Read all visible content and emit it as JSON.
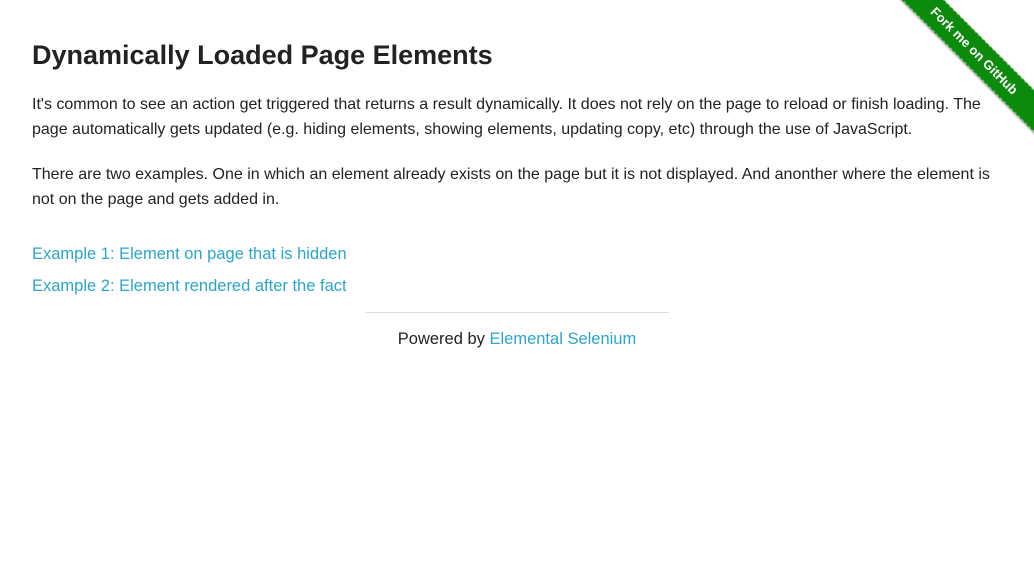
{
  "page": {
    "title": "Dynamically Loaded Page Elements",
    "paragraphs": [
      "It's common to see an action get triggered that returns a result dynamically. It does not rely on the page to reload or finish loading. The page automatically gets updated (e.g. hiding elements, showing elements, updating copy, etc) through the use of JavaScript.",
      "There are two examples. One in which an element already exists on the page but it is not displayed. And anonther where the element is not on the page and gets added in."
    ],
    "links": [
      "Example 1: Element on page that is hidden",
      "Example 2: Element rendered after the fact"
    ]
  },
  "footer": {
    "prefix": "Powered by ",
    "link_text": "Elemental Selenium"
  },
  "ribbon": {
    "label": "Fork me on GitHub"
  },
  "colors": {
    "link": "#2ba6cb",
    "ribbon": "#0c8a0c",
    "text": "#222222"
  }
}
